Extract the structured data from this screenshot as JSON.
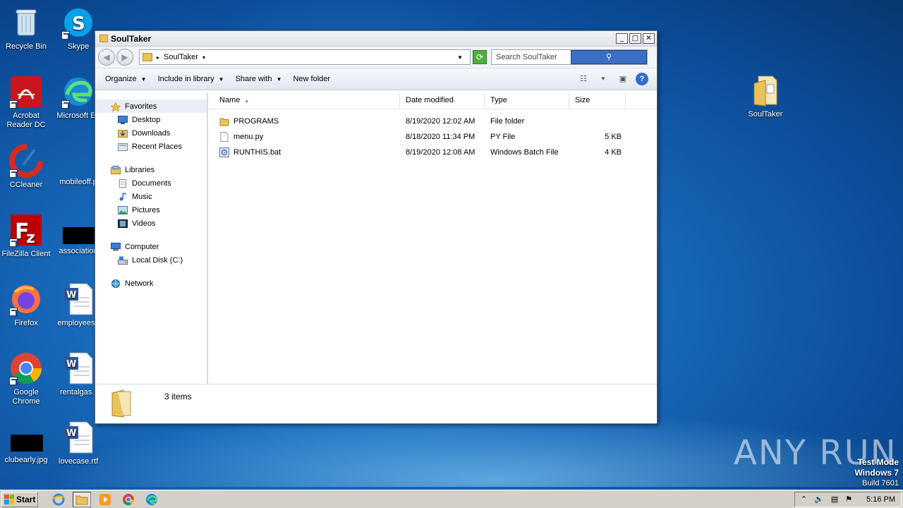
{
  "desktop": {
    "icons": [
      {
        "label": "Recycle Bin",
        "icon": "recycle-bin-icon"
      },
      {
        "label": "Skype",
        "icon": "skype-icon"
      },
      {
        "label": "Acrobat Reader DC",
        "icon": "acrobat-icon"
      },
      {
        "label": "Microsoft Ed",
        "icon": "edge-icon"
      },
      {
        "label": "CCleaner",
        "icon": "ccleaner-icon"
      },
      {
        "label": "mobileoff.p",
        "icon": "document-icon"
      },
      {
        "label": "FileZilla Client",
        "icon": "filezilla-icon"
      },
      {
        "label": "association",
        "icon": "image-file-icon"
      },
      {
        "label": "Firefox",
        "icon": "firefox-icon"
      },
      {
        "label": "employeesh",
        "icon": "word-document-icon"
      },
      {
        "label": "Google Chrome",
        "icon": "chrome-icon"
      },
      {
        "label": "rentalgas.r",
        "icon": "word-document-icon"
      },
      {
        "label": "clubearly.jpg",
        "icon": "image-file-icon"
      },
      {
        "label": "lovecase.rtf",
        "icon": "word-document-icon"
      },
      {
        "label": "SoulTaker",
        "icon": "folder-icon"
      }
    ],
    "watermark": "ANY RUN",
    "testmode": {
      "line1": "Test Mode",
      "line2": "Windows 7",
      "line3": "Build 7601"
    }
  },
  "window": {
    "title": "SoulTaker",
    "address": "SoulTaker",
    "search_placeholder": "Search SoulTaker",
    "toolbar": {
      "organize": "Organize",
      "include_in_library": "Include in library",
      "share_with": "Share with",
      "new_folder": "New folder"
    },
    "nav": {
      "favorites": "Favorites",
      "desktop": "Desktop",
      "downloads": "Downloads",
      "recent_places": "Recent Places",
      "libraries": "Libraries",
      "documents": "Documents",
      "music": "Music",
      "pictures": "Pictures",
      "videos": "Videos",
      "computer": "Computer",
      "local_disk": "Local Disk (C:)",
      "network": "Network"
    },
    "columns": {
      "name": "Name",
      "date": "Date modified",
      "type": "Type",
      "size": "Size"
    },
    "files": [
      {
        "name": "PROGRAMS",
        "date": "8/19/2020 12:02 AM",
        "type": "File folder",
        "size": ""
      },
      {
        "name": "menu.py",
        "date": "8/18/2020 11:34 PM",
        "type": "PY File",
        "size": "5 KB"
      },
      {
        "name": "RUNTHIS.bat",
        "date": "8/19/2020 12:08 AM",
        "type": "Windows Batch File",
        "size": "4 KB"
      }
    ],
    "status": "3 items"
  },
  "taskbar": {
    "start": "Start",
    "clock": "5:16 PM"
  },
  "colors": {
    "desktop": "#1767b8",
    "folder": "#e9c25a",
    "taskbar": "#d4d0c8"
  }
}
